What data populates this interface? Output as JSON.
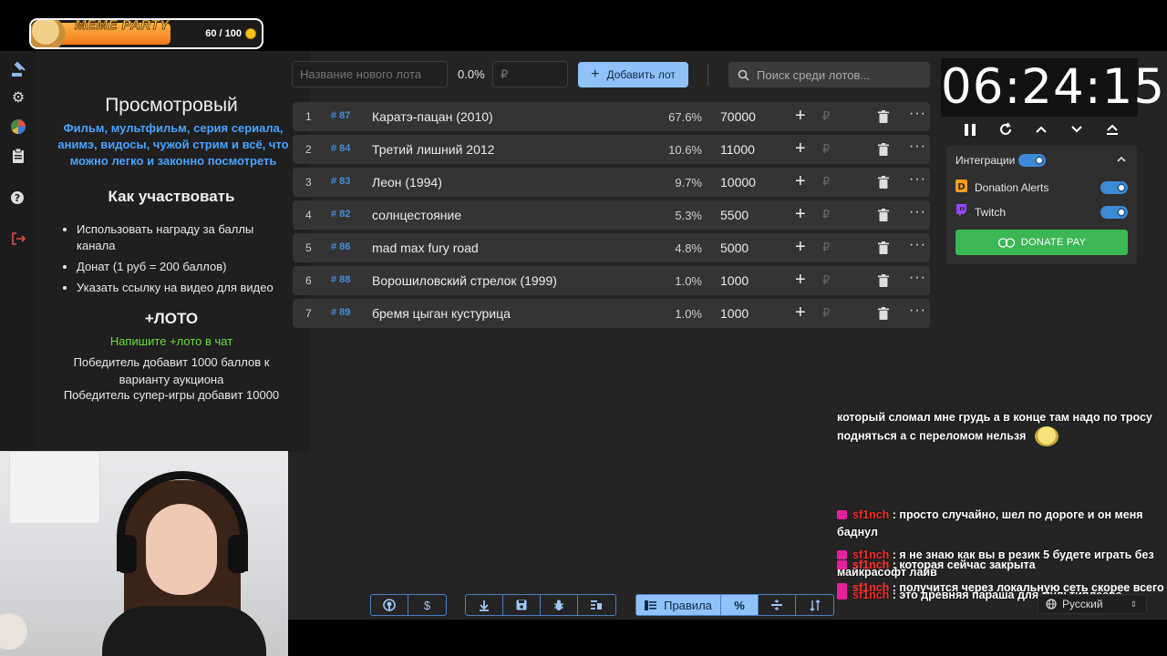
{
  "meme_widget": {
    "title": "MEME PARTY",
    "progress": "60 / 100",
    "progress_value": 60,
    "progress_max": 100
  },
  "sidebar": {
    "items": [
      {
        "icon": "auction-hammer-icon"
      },
      {
        "icon": "gear-icon"
      },
      {
        "icon": "pie-chart-icon"
      },
      {
        "icon": "clipboard-icon"
      },
      {
        "icon": "help-icon"
      },
      {
        "icon": "logout-icon"
      }
    ]
  },
  "rules": {
    "title": "Просмотровый",
    "subtitle": "Фильм, мультфильм, серия сериала, анимэ, видосы, чужой стрим и всё, что можно легко и законно посмотреть",
    "how_title": "Как участвовать",
    "how_items": [
      "Использовать награду за баллы канала",
      "Донат (1 руб = 200 баллов)",
      "Указать ссылку на видео для видео"
    ],
    "loto_title": "+ЛОТО",
    "loto_hint": "Напишите +лото в чат",
    "loto_p1": "Победитель добавит 1000 баллов к варианту аукциона",
    "loto_p2": "Победитель супер-игры добавит 10000"
  },
  "topbar": {
    "new_lot_placeholder": "Название нового лота",
    "percent": "0.0%",
    "amount_placeholder": "₽",
    "add_lot_label": "Добавить лот",
    "search_placeholder": "Поиск среди лотов..."
  },
  "lots": [
    {
      "num": "1",
      "id": "# 87",
      "name": "Каратэ-пацан (2010)",
      "pct": "67.6%",
      "amount": "70000"
    },
    {
      "num": "2",
      "id": "# 84",
      "name": "Третий лишний 2012",
      "pct": "10.6%",
      "amount": "11000"
    },
    {
      "num": "3",
      "id": "# 83",
      "name": "Леон (1994)",
      "pct": "9.7%",
      "amount": "10000"
    },
    {
      "num": "4",
      "id": "# 82",
      "name": "солнцестояние",
      "pct": "5.3%",
      "amount": "5500"
    },
    {
      "num": "5",
      "id": "# 86",
      "name": "mad max fury road",
      "pct": "4.8%",
      "amount": "5000"
    },
    {
      "num": "6",
      "id": "# 88",
      "name": "Ворошиловский стрелок (1999)",
      "pct": "1.0%",
      "amount": "1000"
    },
    {
      "num": "7",
      "id": "# 89",
      "name": "бремя цыган кустурица",
      "pct": "1.0%",
      "amount": "1000"
    }
  ],
  "lot_symbols": {
    "plus": "+",
    "rub": "₽",
    "more": "···"
  },
  "timer": {
    "value": "06:24:15"
  },
  "integrations": {
    "title": "Интеграции",
    "donation_alerts": "Donation Alerts",
    "twitch": "Twitch",
    "donate_pay": "DONATE PAY"
  },
  "chat": [
    {
      "user": "",
      "text": "который сломал мне грудь а в конце там надо по тросу подняться а с переломом нельзя"
    },
    {
      "user": "sf1nch",
      "text": " : просто случайно, шел по дороге и он меня баднул"
    },
    {
      "user": "sf1nch",
      "text": " : я не знаю как вы в резик 5 будете играть без майкрасофт лайв"
    },
    {
      "user": "sf1nch",
      "text": " : это древняя параша для мультиплеера"
    },
    {
      "user": "sf1nch",
      "text": " : которая сейчас закрыта"
    },
    {
      "user": "sf1nch",
      "text": " : получится через локальную сеть скорее всего"
    }
  ],
  "toolbar": {
    "rules_label": "Правила"
  },
  "language": {
    "value": "Русский"
  },
  "colors": {
    "accent": "#90c2f9",
    "link": "#4aa3ff",
    "green": "#3cb756",
    "loto_green": "#6ddf3a",
    "chat_user": "#ff2a2a"
  }
}
